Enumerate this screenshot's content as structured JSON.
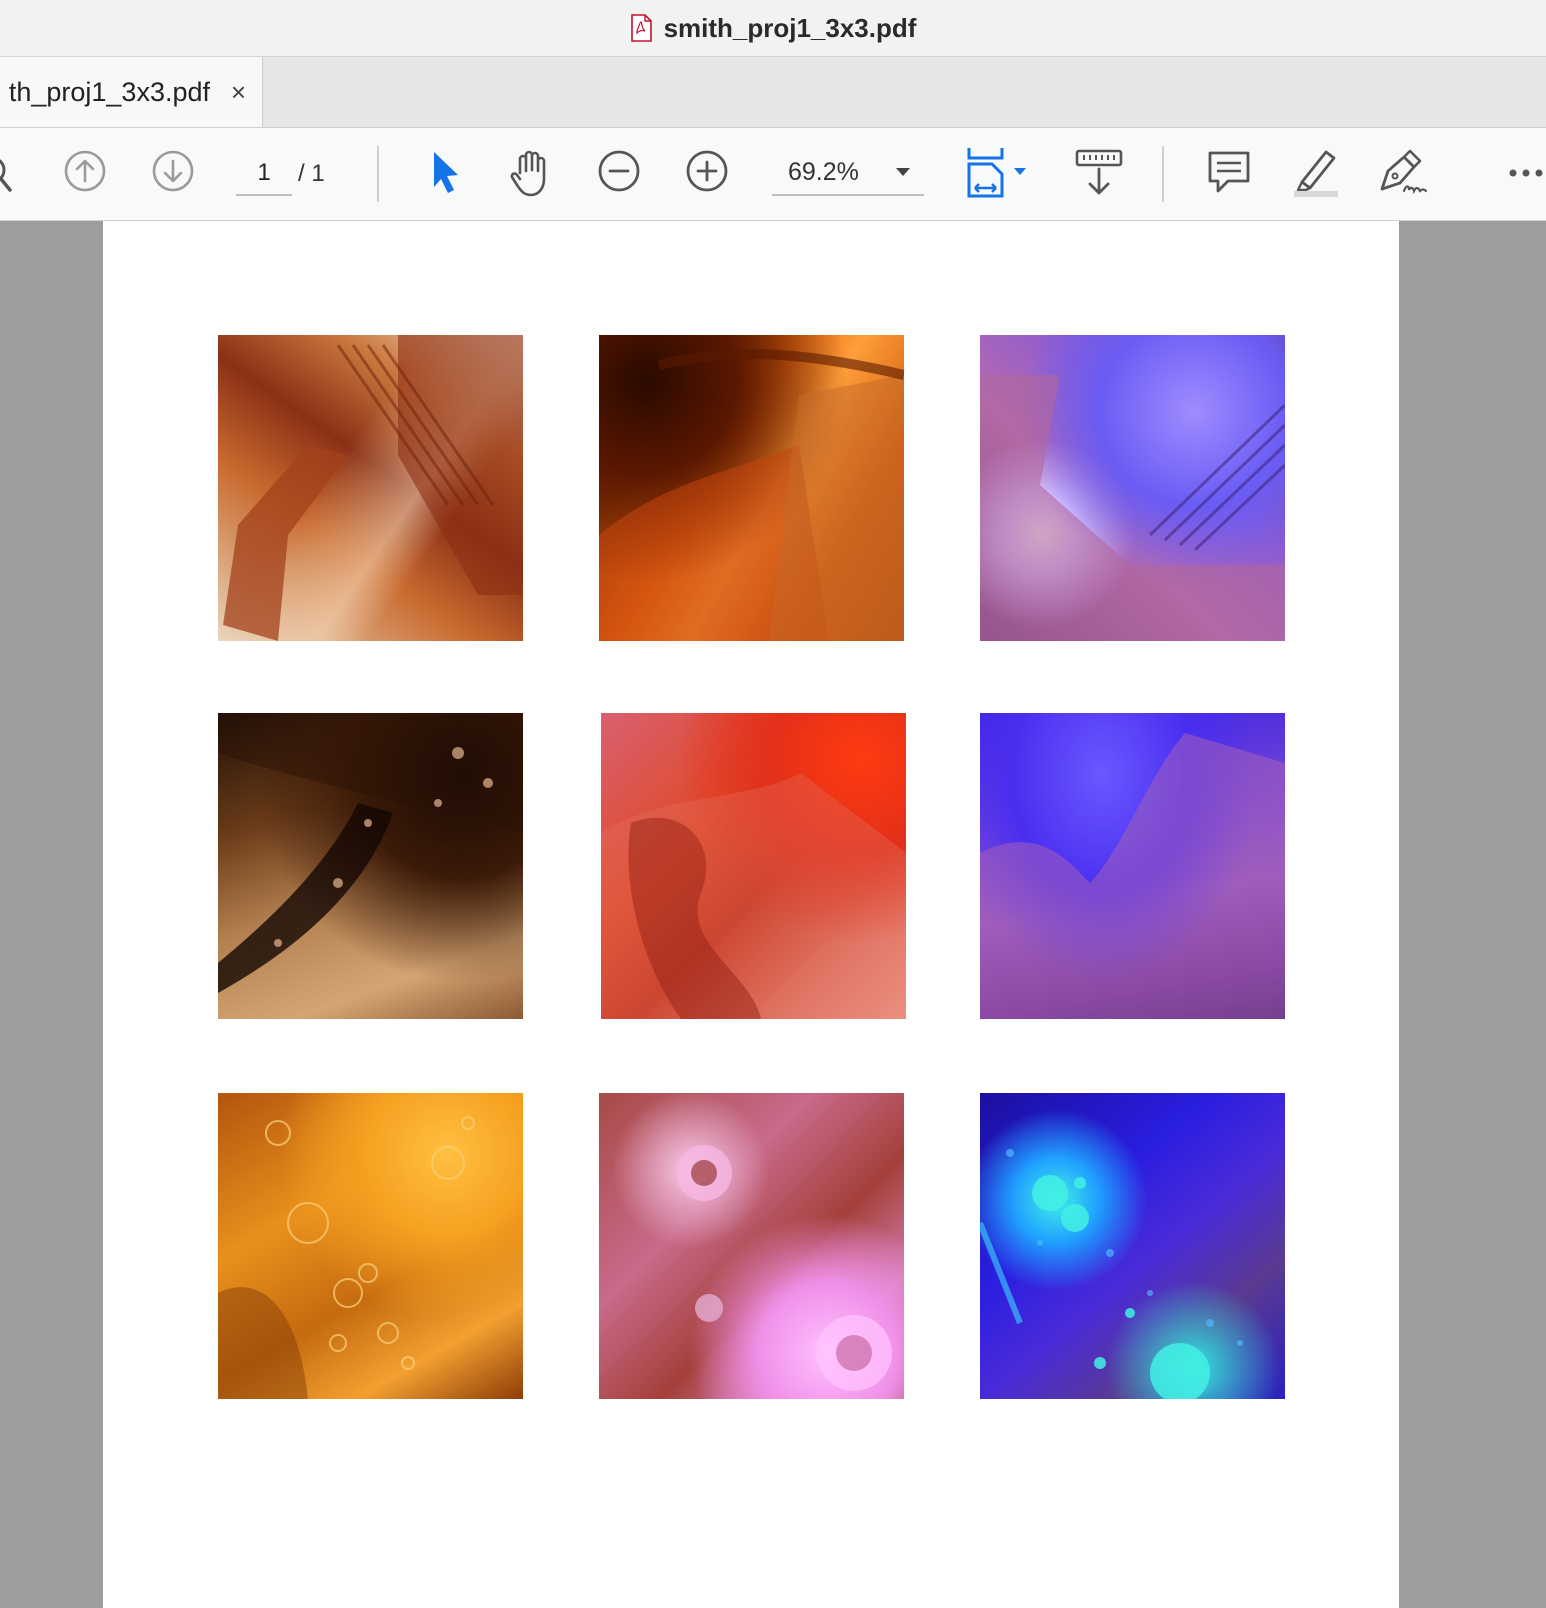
{
  "window": {
    "title": "smith_proj1_3x3.pdf"
  },
  "tab": {
    "label": "th_proj1_3x3.pdf",
    "close": "×"
  },
  "toolbar": {
    "page_current": "1",
    "page_total": "/ 1",
    "zoom": "69.2%"
  },
  "icons": {
    "file": "pdf-file-icon",
    "find": "search-icon",
    "prev": "arrow-up-circle-icon",
    "next": "arrow-down-circle-icon",
    "select": "pointer-arrow-icon",
    "hand": "hand-icon",
    "zoom_out": "minus-circle-icon",
    "zoom_in": "plus-circle-icon",
    "fit": "fit-page-icon",
    "scroll": "scroll-mode-icon",
    "comment": "comment-icon",
    "highlight": "highlighter-icon",
    "sign": "signature-pen-icon",
    "more": "more-icon"
  },
  "colors": {
    "accent": "#1473e6",
    "icon_gray": "#555555"
  },
  "document": {
    "images": [
      "image-1",
      "image-2",
      "image-3",
      "image-4",
      "image-5",
      "image-6",
      "image-7",
      "image-8",
      "image-9"
    ]
  }
}
